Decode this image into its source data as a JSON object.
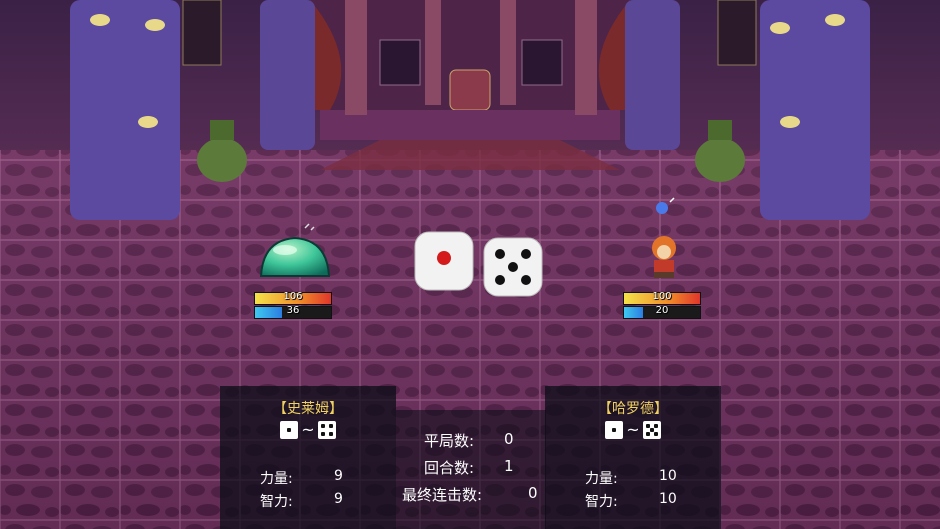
{
  "player": {
    "name": "【史莱姆】",
    "hp": 106,
    "hp_fraction": 1.0,
    "mp": 36,
    "mp_fraction": 0.35,
    "stats": [
      {
        "label": "力量:",
        "value": "9"
      },
      {
        "label": "智力:",
        "value": "9"
      }
    ]
  },
  "enemy": {
    "name": "【哈罗德】",
    "hp": 100,
    "hp_fraction": 1.0,
    "mp": 20,
    "mp_fraction": 0.25,
    "stats": [
      {
        "label": "力量:",
        "value": "10"
      },
      {
        "label": "智力:",
        "value": "10"
      }
    ]
  },
  "dice_range_separator": "~",
  "match": {
    "rows": [
      {
        "label": "平局数:",
        "value": "0"
      },
      {
        "label": "回合数:",
        "value": "1"
      },
      {
        "label": "最终连击数:",
        "value": "0"
      }
    ]
  },
  "dice": {
    "left_face": 1,
    "right_face": 5
  },
  "colors": {
    "name_gold": "#f0d060",
    "slime": "#3fc79a",
    "floor": "#7a3a6a"
  },
  "icons": [
    "dice-one-icon",
    "dice-four-icon",
    "dice-five-icon"
  ]
}
